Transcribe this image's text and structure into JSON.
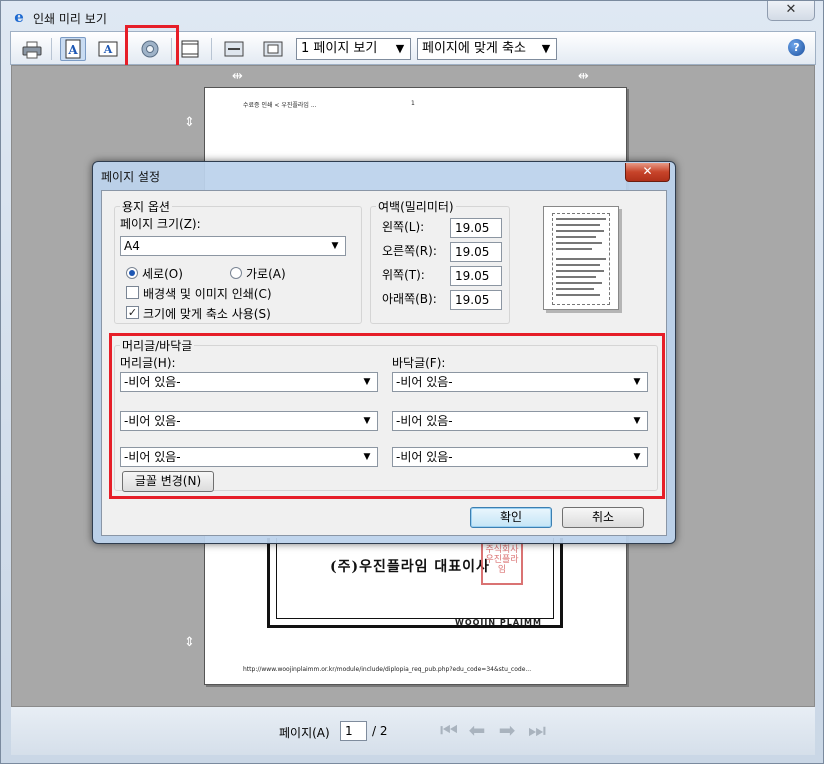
{
  "window": {
    "title": "인쇄 미리 보기",
    "close_symbol": "✕",
    "app_icon": "ie-logo-icon"
  },
  "toolbar": {
    "print_icon": "print-icon",
    "portrait_icon": "portrait-icon",
    "landscape_icon": "landscape-icon",
    "page_setup_icon": "gear-icon",
    "header_footer_icon": "header-footer-icon",
    "full_width_icon": "full-width-icon",
    "full_page_icon": "full-page-icon",
    "view_select": "1 페이지 보기",
    "zoom_select": "페이지에 맞게 축소",
    "help_icon": "help-icon",
    "help_symbol": "?"
  },
  "preview": {
    "page_header_left": "수료증 인쇄 < 우진플라임 ...",
    "page_header_number": "1",
    "company_sign": "(주)우진플라임 대표이사",
    "seal_text": "주식회사우진플라임",
    "logo_text": "WOOJIN PLAIMM",
    "page_footer_url": "http://www.woojinplaimm.or.kr/module/include/diplopia_req_pub.php?edu_code=34&stu_code..."
  },
  "statusbar": {
    "page_label": "페이지(A)",
    "page_current": "1",
    "page_total": "/ 2",
    "nav_first": "⏮",
    "nav_prev": "⬅",
    "nav_next": "➡",
    "nav_last": "⏭"
  },
  "dialog": {
    "title": "페이지 설정",
    "close_symbol": "✕",
    "paper_group": "용지 옵션",
    "paper_size_label": "페이지 크기(Z):",
    "paper_size_value": "A4",
    "portrait_label": "세로(O)",
    "landscape_label": "가로(A)",
    "orientation_selected": "portrait",
    "print_background_label": "배경색 및 이미지 인쇄(C)",
    "print_background_checked": false,
    "shrink_to_fit_label": "크기에 맞게 축소 사용(S)",
    "shrink_to_fit_checked": true,
    "check_mark": "✓",
    "margins_group": "여백(밀리미터)",
    "margin_left_label": "왼쪽(L):",
    "margin_left_value": "19.05",
    "margin_right_label": "오른쪽(R):",
    "margin_right_value": "19.05",
    "margin_top_label": "위쪽(T):",
    "margin_top_value": "19.05",
    "margin_bottom_label": "아래쪽(B):",
    "margin_bottom_value": "19.05",
    "hf_group": "머리글/바닥글",
    "header_label": "머리글(H):",
    "footer_label": "바닥글(F):",
    "header_values": [
      "-비어 있음-",
      "-비어 있음-",
      "-비어 있음-"
    ],
    "footer_values": [
      "-비어 있음-",
      "-비어 있음-",
      "-비어 있음-"
    ],
    "font_button": "글꼴 변경(N)",
    "ok_button": "확인",
    "cancel_button": "취소"
  },
  "annotations": {
    "highlight_color": "#e61e28"
  }
}
